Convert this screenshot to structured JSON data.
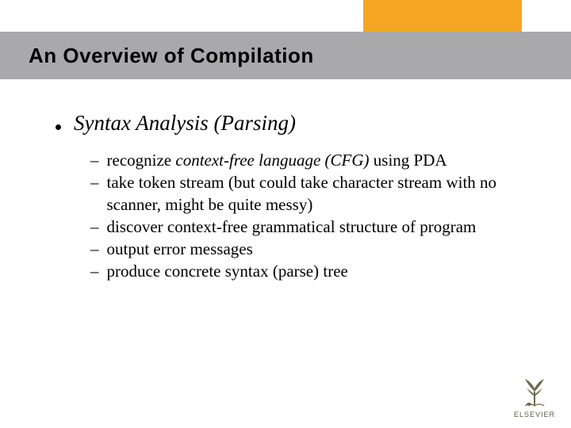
{
  "header": {
    "title": "An Overview of Compilation"
  },
  "main_bullet": {
    "label": "Syntax Analysis (Parsing)"
  },
  "sub_bullets": [
    {
      "prefix": "recognize ",
      "italic": "context-free language (CFG)",
      "suffix": " using PDA"
    },
    {
      "text": "take token stream (but could take character stream with no scanner, might be quite messy)"
    },
    {
      "text": "discover context-free grammatical structure of program"
    },
    {
      "text": "output error messages"
    },
    {
      "text": "produce concrete syntax (parse) tree"
    }
  ],
  "publisher": {
    "name": "ELSEVIER"
  }
}
